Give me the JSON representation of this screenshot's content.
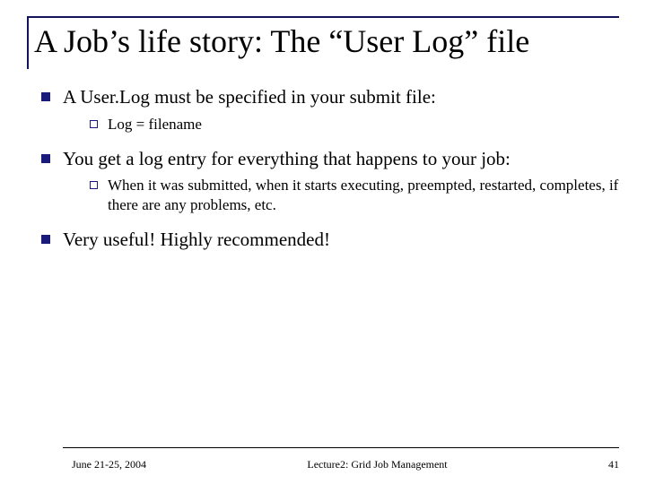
{
  "title": "A Job’s life story: The “User Log” file",
  "bullets": {
    "b1": {
      "text": "A User.Log must be specified in your submit file:",
      "sub1": "Log = filename"
    },
    "b2": {
      "text": "You get a log entry for everything that happens to your job:",
      "sub1": "When it was submitted, when it starts executing, preempted, restarted, completes, if there are any problems, etc."
    },
    "b3": {
      "text": "Very useful!  Highly recommended!"
    }
  },
  "footer": {
    "date": "June 21-25, 2004",
    "lecture": "Lecture2: Grid Job Management",
    "page": "41"
  }
}
